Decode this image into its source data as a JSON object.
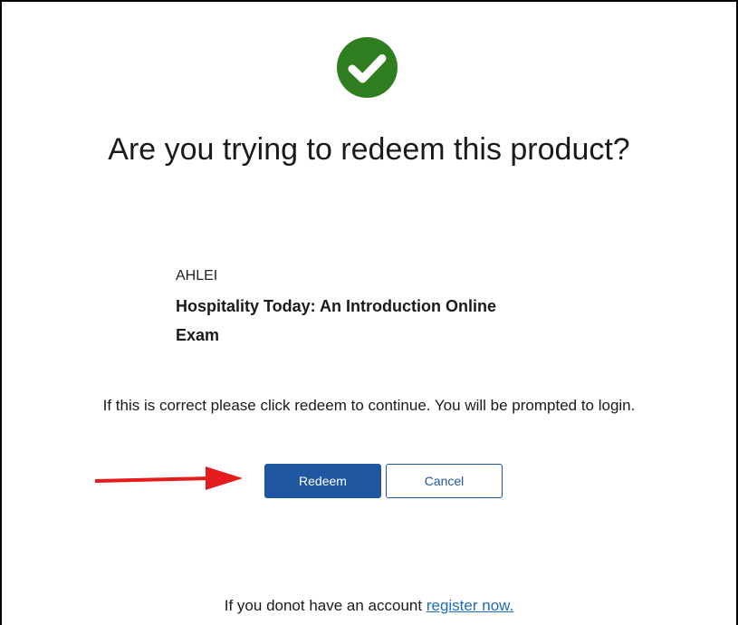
{
  "icon": {
    "name": "check-circle-icon",
    "color": "#2e7d1f"
  },
  "dialog": {
    "title": "Are you trying to redeem this product?"
  },
  "product": {
    "vendor": "AHLEI",
    "name_line1": "Hospitality Today: An Introduction Online",
    "name_line2": "Exam"
  },
  "instruction": "If this is correct please click redeem to continue. You will be prompted to login.",
  "annotation": {
    "arrow_color": "#e51c1c"
  },
  "buttons": {
    "redeem_label": "Redeem",
    "cancel_label": "Cancel",
    "primary_color": "#1e56a0"
  },
  "footer": {
    "prompt": "If you donot have an account ",
    "link_label": "register now."
  }
}
